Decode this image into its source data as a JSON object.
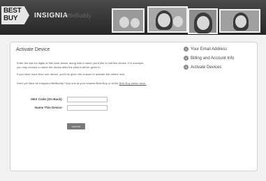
{
  "header": {
    "logo_line1": "BEST",
    "logo_line2": "BUY",
    "brand": "INSIGNIA",
    "product": "LittleBuddy"
  },
  "main": {
    "title": "Activate Device",
    "para1_line1": "Enter the last six digits of this code below, along with a name you'd like to call this device. For example,",
    "para1_line2": "you may choose to name the device after the child it will be given to.",
    "para2": "If you have more than one device, you'll be given the chance to activate the others next.",
    "para3_prefix": "Don't yet have an Insignia LittleBuddy? Buy one at your nearest Best Buy or at the",
    "para3_link": "Best Buy online store.",
    "hex_label": "HEX Code (On Back):",
    "hex_value": "",
    "name_label": "Name This Device:",
    "name_value": "",
    "submit_label": "submit"
  },
  "steps": [
    {
      "number": "1",
      "label": "Your Email Address"
    },
    {
      "number": "2",
      "label": "Billing and Account Info"
    },
    {
      "number": "3",
      "label": "Activate Devices"
    }
  ],
  "colors": {
    "header_bg": "#2f2f2f",
    "step_badge": "#888888",
    "submit_bg": "#7a7a7a"
  }
}
